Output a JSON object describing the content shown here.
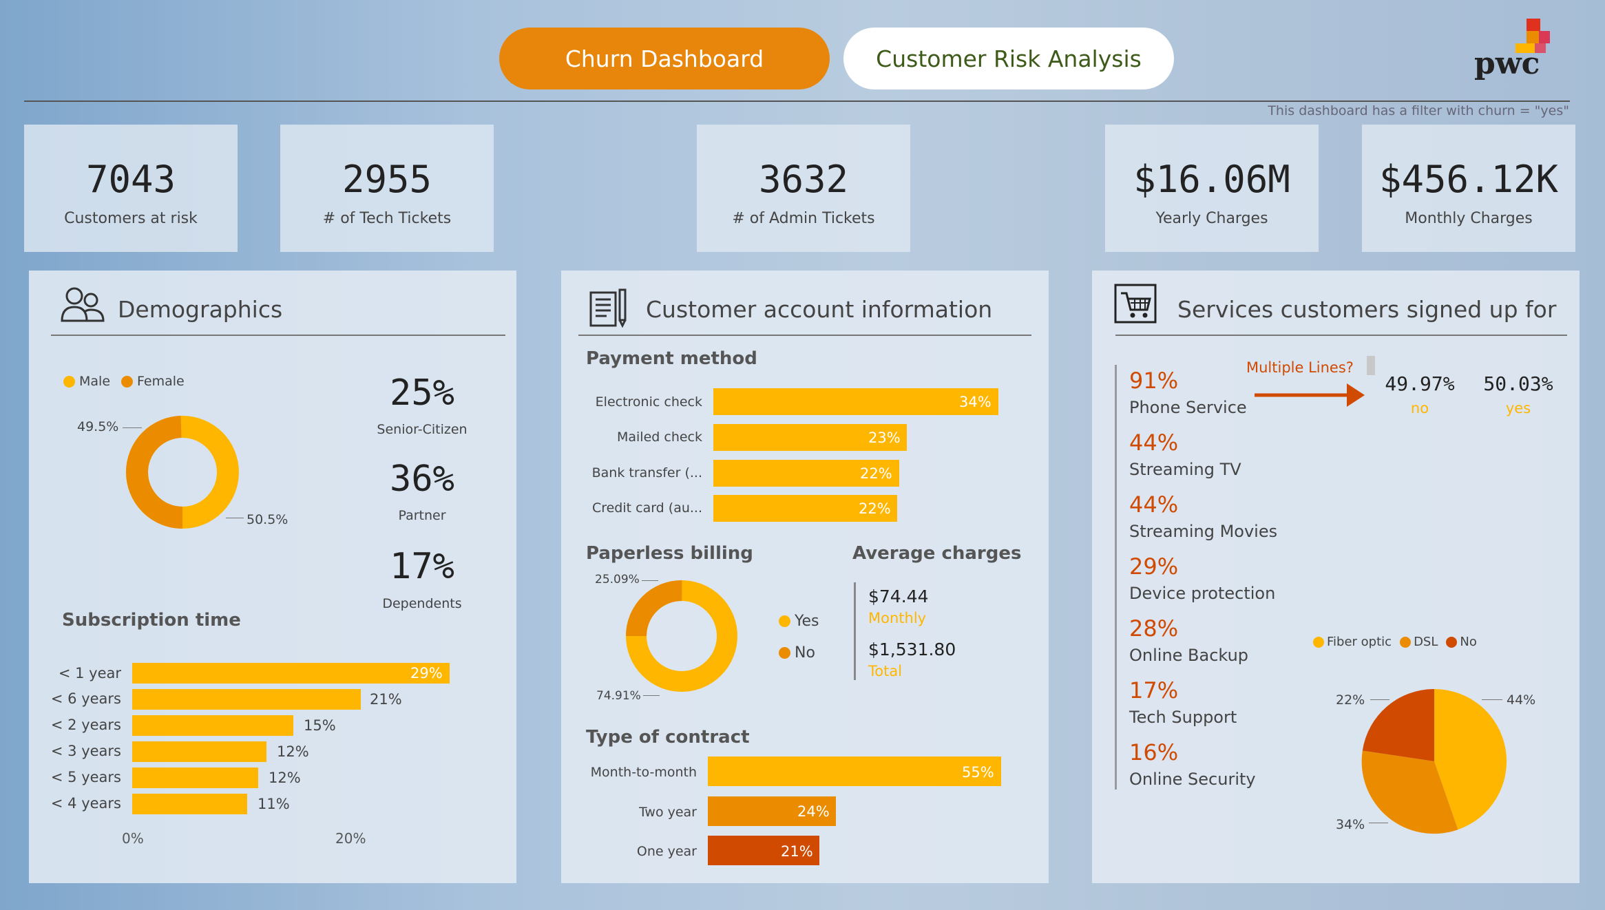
{
  "tabs": {
    "churn": "Churn Dashboard",
    "risk": "Customer Risk Analysis"
  },
  "brand": {
    "logo_text": "pwc"
  },
  "filter_note": "This dashboard has a filter with churn = \"yes\"",
  "kpis": [
    {
      "value": "7043",
      "label": "Customers at risk"
    },
    {
      "value": "2955",
      "label": "# of Tech Tickets"
    },
    {
      "value": "3632",
      "label": "# of Admin Tickets"
    },
    {
      "value": "$16.06M",
      "label": "Yearly Charges"
    },
    {
      "value": "$456.12K",
      "label": "Monthly Charges"
    }
  ],
  "demographics": {
    "title": "Demographics",
    "legend": [
      "Male",
      "Female"
    ],
    "donut_labels": {
      "male": "49.5%",
      "female": "50.5%"
    },
    "stats": [
      {
        "value": "25%",
        "label": "Senior-Citizen"
      },
      {
        "value": "36%",
        "label": "Partner"
      },
      {
        "value": "17%",
        "label": "Dependents"
      }
    ],
    "subscription_title": "Subscription time",
    "subscription": [
      {
        "label": "< 1 year",
        "value": "29%"
      },
      {
        "label": "< 6 years",
        "value": "21%"
      },
      {
        "label": "< 2 years",
        "value": "15%"
      },
      {
        "label": "< 3 years",
        "value": "12%"
      },
      {
        "label": "< 5 years",
        "value": "12%"
      },
      {
        "label": "< 4 years",
        "value": "11%"
      }
    ],
    "axis": [
      "0%",
      "20%"
    ]
  },
  "account": {
    "title": "Customer account information",
    "payment_title": "Payment method",
    "payment": [
      {
        "label": "Electronic check",
        "value": "34%"
      },
      {
        "label": "Mailed check",
        "value": "23%"
      },
      {
        "label": "Bank transfer (...",
        "value": "22%"
      },
      {
        "label": "Credit card (au...",
        "value": "22%"
      }
    ],
    "paperless_title": "Paperless billing",
    "paperless_labels": {
      "no": "25.09%",
      "yes": "74.91%"
    },
    "paperless_legend": [
      "Yes",
      "No"
    ],
    "avg_title": "Average charges",
    "avg_monthly": "$74.44",
    "avg_monthly_label": "Monthly",
    "avg_total": "$1,531.80",
    "avg_total_label": "Total",
    "contract_title": "Type of contract",
    "contract": [
      {
        "label": "Month-to-month",
        "value": "55%"
      },
      {
        "label": "Two year",
        "value": "24%"
      },
      {
        "label": "One year",
        "value": "21%"
      }
    ]
  },
  "services": {
    "title": "Services customers signed up for",
    "items": [
      {
        "value": "91%",
        "label": "Phone Service"
      },
      {
        "value": "44%",
        "label": "Streaming TV"
      },
      {
        "value": "44%",
        "label": "Streaming Movies"
      },
      {
        "value": "29%",
        "label": "Device protection"
      },
      {
        "value": "28%",
        "label": "Online Backup"
      },
      {
        "value": "17%",
        "label": "Tech Support"
      },
      {
        "value": "16%",
        "label": "Online Security"
      }
    ],
    "multiple_lines_label": "Multiple Lines?",
    "ml_no_value": "49.97%",
    "ml_no_label": "no",
    "ml_yes_value": "50.03%",
    "ml_yes_label": "yes",
    "internet_legend": [
      "Fiber optic",
      "DSL",
      "No"
    ],
    "internet_labels": {
      "fiber": "44%",
      "dsl": "34%",
      "no": "22%"
    }
  },
  "colors": {
    "orange": "#e8860b",
    "yellow": "#ffb600",
    "mid": "#eb8c00",
    "red": "#d04a02"
  }
}
